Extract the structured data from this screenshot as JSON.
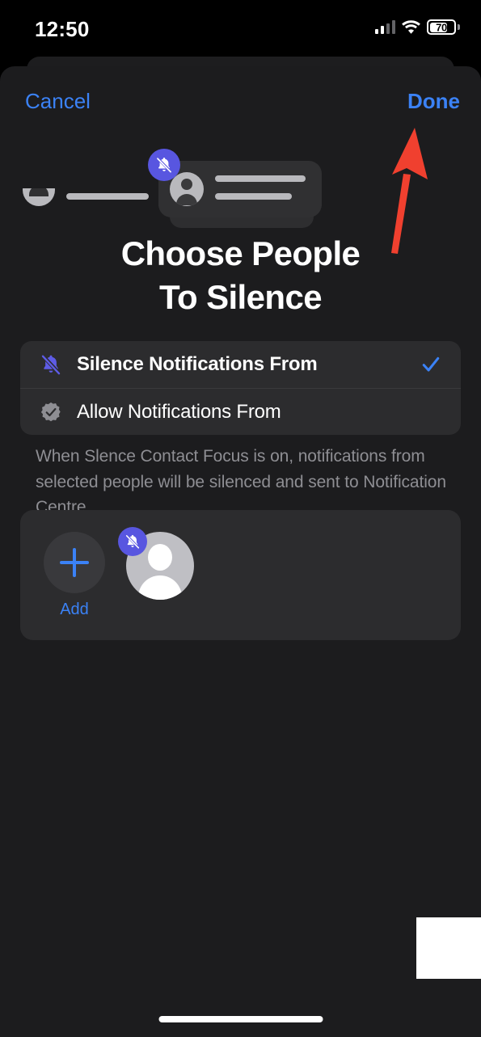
{
  "status_bar": {
    "time": "12:50",
    "battery_level": "70",
    "battery_percent": 70,
    "signal_icon": "cellular-signal-icon",
    "wifi_icon": "wifi-icon",
    "battery_icon": "battery-icon"
  },
  "nav": {
    "cancel_label": "Cancel",
    "done_label": "Done"
  },
  "hero": {
    "badge_icon": "bell-slash-icon",
    "illustration_name": "silenced-notification-illustration"
  },
  "title": {
    "line1": "Choose People",
    "line2": "To Silence"
  },
  "options": [
    {
      "label": "Silence Notifications From",
      "icon": "bell-slash-icon",
      "selected": true,
      "icon_color": "#5e5ce6"
    },
    {
      "label": "Allow Notifications From",
      "icon": "badge-check-icon",
      "selected": false,
      "icon_color": "#8e8e93"
    }
  ],
  "description": "When Slence Contact Focus is on, notifications from selected people will be silenced and sent to Notification Centre.",
  "people": {
    "add_label": "Add",
    "add_icon": "plus-icon",
    "contact_avatar_icon": "person-avatar-icon",
    "contact_badge_icon": "bell-slash-icon"
  },
  "annotation": {
    "arrow_icon": "red-arrow-pointing-to-done",
    "color": "#f0402f"
  },
  "colors": {
    "accent_blue": "#3b82f6",
    "purple": "#5856e0",
    "sheet_background": "#1c1c1e",
    "card_background": "#2c2c2e",
    "secondary_text": "#8e8e93"
  }
}
